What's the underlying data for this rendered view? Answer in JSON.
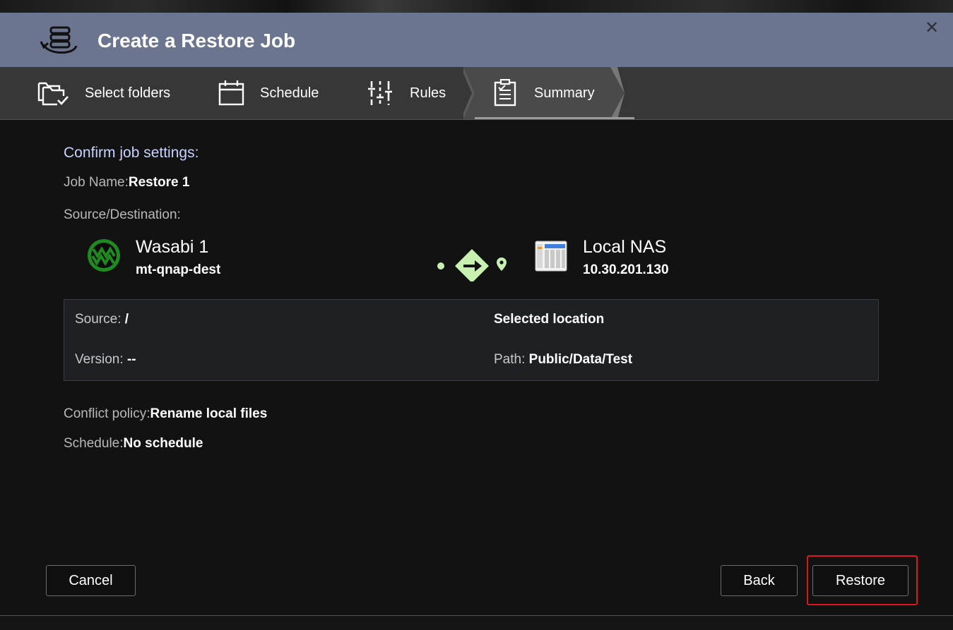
{
  "dialog": {
    "title": "Create a Restore Job",
    "close_glyph": "✕"
  },
  "steps": [
    {
      "label": "Select folders",
      "icon": "folders-check-icon"
    },
    {
      "label": "Schedule",
      "icon": "calendar-icon"
    },
    {
      "label": "Rules",
      "icon": "sliders-icon"
    },
    {
      "label": "Summary",
      "icon": "clipboard-icon",
      "active": true
    }
  ],
  "summary": {
    "heading": "Confirm job settings:",
    "job_name_label": "Job Name:",
    "job_name_value": "Restore 1",
    "source_destination_label": "Source/Destination:",
    "source": {
      "name": "Wasabi 1",
      "sub": "mt-qnap-dest",
      "icon": "wasabi-logo-icon"
    },
    "destination": {
      "name": "Local NAS",
      "sub": "10.30.201.130",
      "icon": "nas-device-icon"
    },
    "details": {
      "source_label": "Source:",
      "source_value": "/",
      "version_label": "Version:",
      "version_value": "--",
      "selected_location": "Selected location",
      "path_label": "Path:",
      "path_value": "Public/Data/Test"
    },
    "conflict_label": "Conflict policy:",
    "conflict_value": "Rename local files",
    "schedule_label": "Schedule:",
    "schedule_value": "No schedule"
  },
  "buttons": {
    "cancel": "Cancel",
    "back": "Back",
    "restore": "Restore"
  },
  "colors": {
    "titlebar": "#6c7590",
    "accent_text": "#c7d2ff",
    "flow_green": "#c8f0b0",
    "wasabi_green": "#1f8a1f",
    "highlight_red": "#e0141b"
  }
}
